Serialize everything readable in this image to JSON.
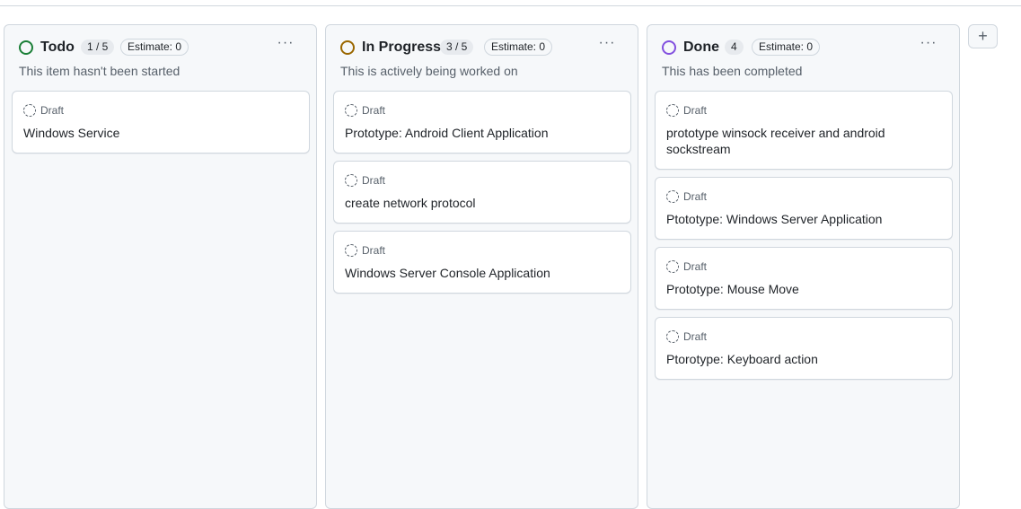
{
  "columns": [
    {
      "name": "Todo",
      "count": "1 / 5",
      "estimate": "Estimate: 0",
      "description": "This item hasn't been started",
      "status_color": "#1a7f37",
      "cards": [
        {
          "status": "Draft",
          "title": "Windows Service"
        }
      ]
    },
    {
      "name": "In Progress",
      "count": "3 / 5",
      "estimate": "Estimate: 0",
      "description": "This is actively being worked on",
      "status_color": "#9a6700",
      "cards": [
        {
          "status": "Draft",
          "title": "Prototype: Android Client Application"
        },
        {
          "status": "Draft",
          "title": "create network protocol"
        },
        {
          "status": "Draft",
          "title": "Windows Server Console Application"
        }
      ]
    },
    {
      "name": "Done",
      "count": "4",
      "estimate": "Estimate: 0",
      "description": "This has been completed",
      "status_color": "#8250df",
      "cards": [
        {
          "status": "Draft",
          "title": "prototype winsock receiver and android sockstream"
        },
        {
          "status": "Draft",
          "title": "Ptototype: Windows Server Application"
        },
        {
          "status": "Draft",
          "title": "Prototype: Mouse Move"
        },
        {
          "status": "Draft",
          "title": "Ptorotype: Keyboard action"
        }
      ]
    }
  ],
  "more_label": "···",
  "add_column_label": "+",
  "icons": {
    "status": "status-circle-icon",
    "draft": "draft-issue-icon",
    "more": "kebab-horizontal-icon",
    "add": "plus-icon"
  }
}
